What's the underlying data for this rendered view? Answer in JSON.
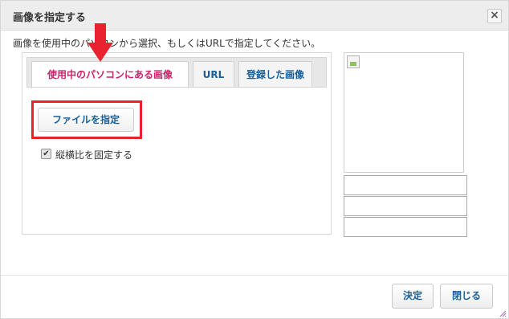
{
  "dialog": {
    "title": "画像を指定する",
    "close_glyph": "×"
  },
  "instruction": "画像を使用中のパソコンから選択、もしくはURLで指定してください。",
  "tabs": [
    {
      "label": "使用中のパソコンにある画像",
      "active": true
    },
    {
      "label": "URL",
      "active": false
    },
    {
      "label": "登録した画像",
      "active": false
    }
  ],
  "file_button": "ファイルを指定",
  "aspect": {
    "label": "縦横比を固定する",
    "checked": true,
    "check_glyph": "✔"
  },
  "footer": {
    "ok_label": "決定",
    "close_label": "閉じる"
  },
  "colors": {
    "annotation_red": "#e8222e",
    "active_tab_text": "#d0206a",
    "link_blue": "#1a5f99",
    "resize_grip": "#b07ab8"
  }
}
